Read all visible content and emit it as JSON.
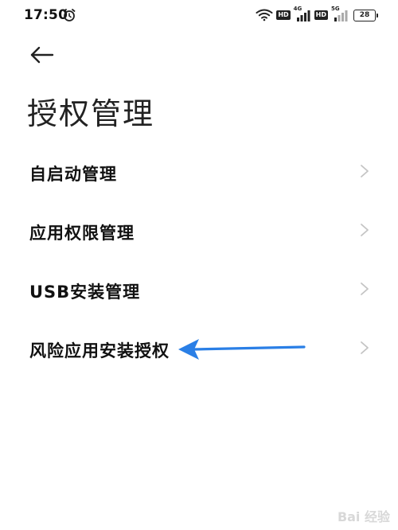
{
  "status_bar": {
    "time": "17:50",
    "icons": [
      "alarm-icon",
      "wifi-icon",
      "hd-badge",
      "signal-4g-icon",
      "hd-badge",
      "signal-5g-icon",
      "battery-icon"
    ],
    "hd_label": "HD",
    "net_4g": "4G",
    "net_5g": "5G",
    "battery": "28"
  },
  "header": {
    "back_icon": "arrow-left-icon",
    "title": "授权管理"
  },
  "settings": {
    "items": [
      {
        "label": "自启动管理"
      },
      {
        "label": "应用权限管理"
      },
      {
        "label": "USB安装管理"
      },
      {
        "label": "风险应用安装授权"
      }
    ]
  },
  "annotation": {
    "arrow_color": "#2a7fe6"
  },
  "watermark": {
    "text": "Bai 经验"
  }
}
